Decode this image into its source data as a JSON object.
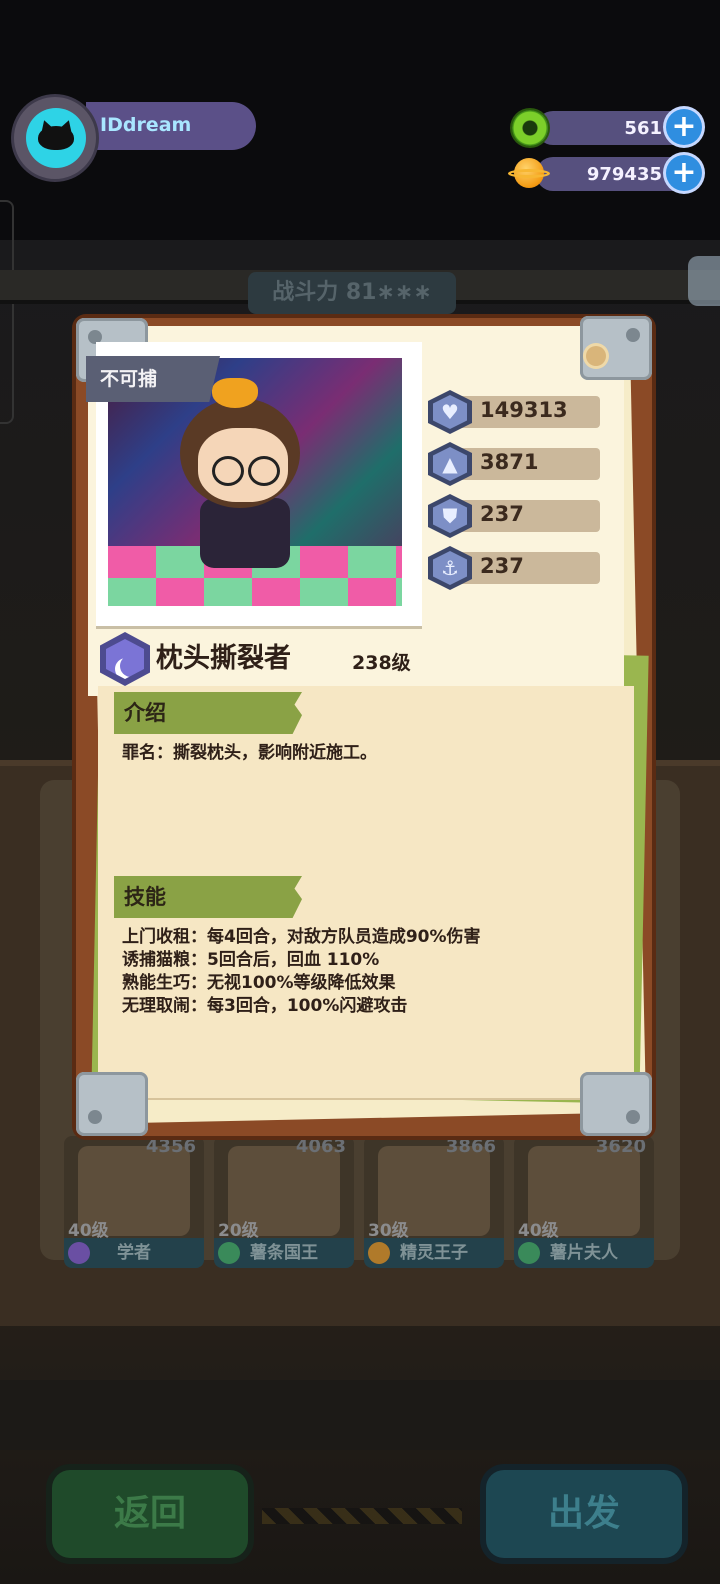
{
  "player": {
    "name": "IDdream"
  },
  "resources": {
    "donuts": "561",
    "coins": "979435"
  },
  "background": {
    "power_text": "战斗力 81∗∗∗",
    "cards": [
      {
        "level": "40级",
        "name": "学者",
        "power": "4356",
        "gem_color": "#6a4fa3"
      },
      {
        "level": "20级",
        "name": "薯条国王",
        "power": "4063",
        "gem_color": "#3a8a5a"
      },
      {
        "level": "30级",
        "name": "精灵王子",
        "power": "3866",
        "gem_color": "#b07a2a"
      },
      {
        "level": "40级",
        "name": "薯片夫人",
        "power": "3620",
        "gem_color": "#3a8a5a"
      }
    ],
    "back_label": "返回",
    "go_label": "出发"
  },
  "dialog": {
    "tag": "不可捕",
    "stats": [
      {
        "icon": "heart-icon",
        "glyph": "♥",
        "value": "149313"
      },
      {
        "icon": "rocket-icon",
        "glyph": "▲",
        "value": "3871"
      },
      {
        "icon": "shield-icon",
        "glyph": "⛊",
        "value": "237"
      },
      {
        "icon": "anchor-icon",
        "glyph": "⚓",
        "value": "237"
      }
    ],
    "name": "枕头撕裂者",
    "level": "238级",
    "intro_title": "介绍",
    "intro_text": "罪名：撕裂枕头，影响附近施工。",
    "skills_title": "技能",
    "skills": [
      "上门收租：每4回合，对敌方队员造成90%伤害",
      "诱捕猫粮：5回合后，回血 110%",
      "熟能生巧：无视100%等级降低效果",
      "无理取闹：每3回合，100%闪避攻击"
    ]
  },
  "colors": {
    "frame": "#8b4a26",
    "tag_green": "#8aa245",
    "hud_bar": "#56507e"
  }
}
